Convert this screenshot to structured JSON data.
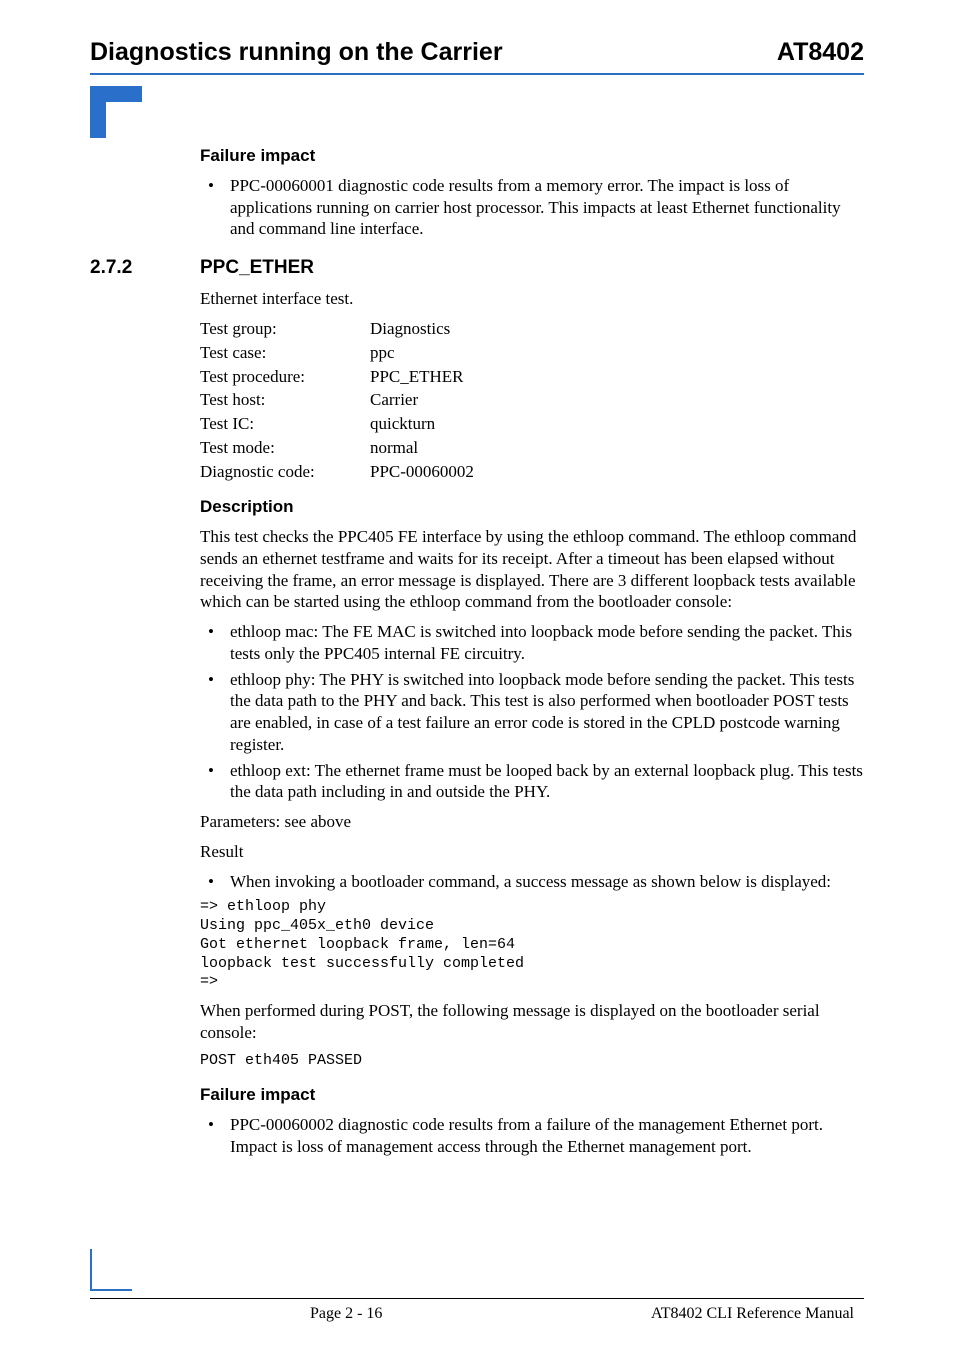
{
  "header": {
    "left": "Diagnostics running on the Carrier",
    "right": "AT8402"
  },
  "sec1": {
    "heading": "Failure impact",
    "bullets": [
      "PPC-00060001 diagnostic code results from a memory error. The impact is loss of applications running on carrier host processor. This impacts at least Ethernet functionality and command line interface."
    ]
  },
  "sec2": {
    "number": "2.7.2",
    "title": "PPC_ETHER",
    "intro": "Ethernet interface test.",
    "defs": [
      {
        "label": "Test group:",
        "value": "Diagnostics"
      },
      {
        "label": "Test case:",
        "value": "ppc"
      },
      {
        "label": "Test procedure:",
        "value": "PPC_ETHER"
      },
      {
        "label": "Test host:",
        "value": "Carrier"
      },
      {
        "label": "Test IC:",
        "value": "quickturn"
      },
      {
        "label": "Test mode:",
        "value": "normal"
      },
      {
        "label": "Diagnostic code:",
        "value": "PPC-00060002"
      }
    ],
    "desc_head": "Description",
    "desc_para": "This test checks the PPC405 FE interface by using the ethloop command. The ethloop command sends an ethernet testframe and waits for its receipt. After a timeout has been elapsed without receiving the frame, an error message is displayed. There are 3 different loopback tests available which can be started using the ethloop command from the bootloader console:",
    "desc_bullets": [
      "ethloop mac: The FE MAC is switched into loopback mode before sending the packet. This tests only the PPC405 internal FE circuitry.",
      "ethloop phy: The PHY is switched into loopback mode before sending the packet. This tests the data path to the PHY and back. This test is also performed when bootloader POST tests are enabled, in case of a test failure an error code is stored in the CPLD postcode warning register.",
      "ethloop ext: The ethernet frame must be looped back by an external loopback plug. This tests the data path including in and outside the PHY."
    ],
    "params": "Parameters: see above",
    "result_label": "Result",
    "result_bullets": [
      "When invoking a bootloader command, a success message as shown below is displayed:"
    ],
    "code1": "=> ethloop phy\nUsing ppc_405x_eth0 device\nGot ethernet loopback frame, len=64\nloopback test successfully completed\n=>",
    "post_para": "When performed during POST, the following message is displayed on the bootloader serial console:",
    "code2": "POST eth405 PASSED",
    "fail_head": "Failure impact",
    "fail_bullets": [
      "PPC-00060002 diagnostic code results from a failure of the management Ethernet port. Impact is loss of management access through the Ethernet management port."
    ]
  },
  "footer": {
    "center": "Page 2 - 16",
    "right": "AT8402 CLI Reference Manual"
  }
}
